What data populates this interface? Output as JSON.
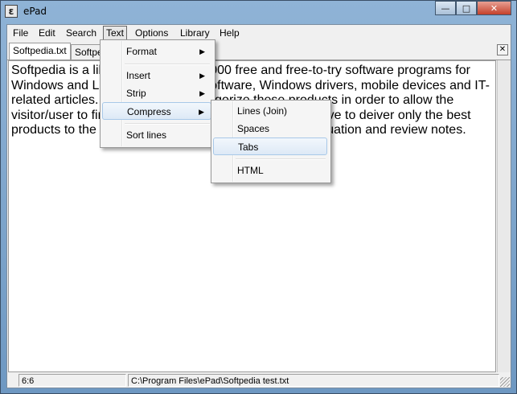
{
  "window": {
    "title": "ePad",
    "icon_glyph": "ε",
    "minimize_glyph": "—",
    "maximize_glyph": "□",
    "close_glyph": "✕"
  },
  "menubar": {
    "items": [
      "File",
      "Edit",
      "Search",
      "Text",
      "Options",
      "Library",
      "Help"
    ],
    "active": "Text"
  },
  "tabs": {
    "items": [
      "Softpedia.txt",
      "Softpe"
    ],
    "close_glyph": "✕"
  },
  "editor": {
    "text": "Softpedia is a library of over 1,300,000 free and free-to-try software programs for Windows and Linux, games, Mac software, Windows drivers, mobile devices and IT-related articles. We review and categorize these products in order to allow the visitor/user to find the exact product they needs. We strive to deiver only the best products to the visitor/user together with self-made evaluation and review notes."
  },
  "status": {
    "position": "6:6",
    "path": "C:\\Program Files\\ePad\\Softpedia test.txt"
  },
  "text_menu": {
    "items": [
      {
        "label": "Format",
        "submenu": true
      },
      {
        "label": "Insert",
        "submenu": true
      },
      {
        "label": "Strip",
        "submenu": true
      },
      {
        "label": "Compress",
        "submenu": true
      },
      {
        "label": "Sort lines",
        "submenu": false
      }
    ],
    "highlighted": "Compress",
    "arrow_glyph": "▶"
  },
  "compress_menu": {
    "items": [
      "Lines (Join)",
      "Spaces",
      "Tabs",
      "HTML"
    ],
    "highlighted": "Tabs"
  },
  "colors": {
    "title_bar": "#7aa2c9",
    "highlight": "#dde9f6",
    "close_button": "#c4402a"
  }
}
